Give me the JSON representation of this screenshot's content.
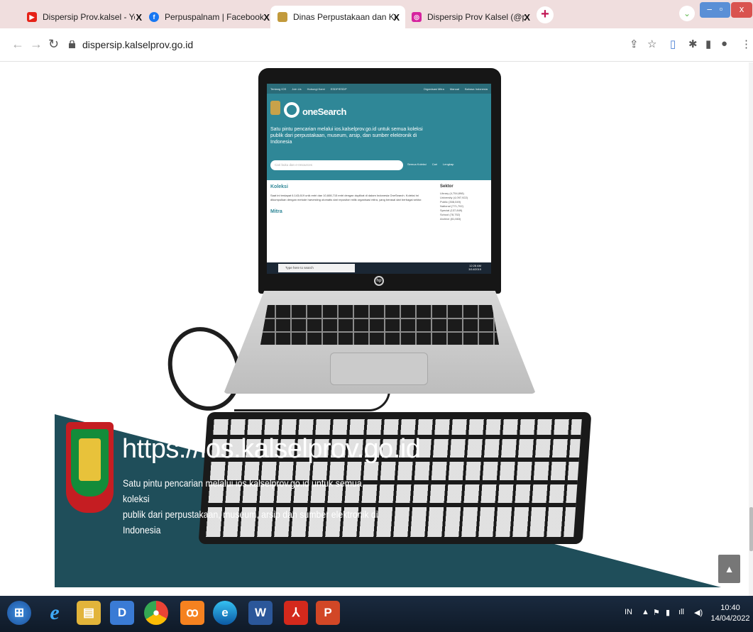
{
  "browser": {
    "tabs": [
      {
        "label": "Dispersip Prov.kalsel - YouTube",
        "icon": "youtube-icon",
        "active": false
      },
      {
        "label": "Perpuspalnam | Facebook",
        "icon": "facebook-icon",
        "active": false
      },
      {
        "label": "Dinas Perpustakaan dan Kearsipa",
        "icon": "site-crest-icon",
        "active": true
      },
      {
        "label": "Dispersip Prov Kalsel (@perpusp",
        "icon": "instagram-icon",
        "active": false
      }
    ],
    "tab_close": "X",
    "new_tab": "+",
    "url": "dispersip.kalselprov.go.id"
  },
  "laptop_screen": {
    "nav_items": [
      "Tentang IOS",
      "Join Us",
      "Hubungi Kami",
      "ESDP/ESDP"
    ],
    "nav_right": [
      "Organisasi Mitra",
      "Manual",
      "Bahasa Indonesia"
    ],
    "logo_text": "oneSearch",
    "hero_text": "Satu pintu pencarian melalui ios.kalselprov.go.id untuk semua koleksi publik dari perpustakaan, museum, arsip, dan sumber elektronik di Indonesia",
    "search_placeholder": "Cari buku dan e-resources",
    "search_buttons": [
      "Semua Koleksi",
      "Cari",
      "Lengkap"
    ],
    "section_koleksi": "Koleksi",
    "koleksi_text": "Saat ini terdapat 6.143,619 unik entri dan 10,608,715 entri dengan duplikat di dalam Indonesia OneSearch. Koleksi ini dikumpulkan dengan metode harvesting otomatis dari repositori milik organisasi mitra, yang berasal dari berbagai sektor.",
    "section_mitra": "Mitra",
    "sektor_title": "Sektor",
    "sektor_items": [
      "Library (4,754,898)",
      "University (4,097,922)",
      "Public (308,049)",
      "National (771,702)",
      "Special (137,849)",
      "School (78,752)",
      "Archive (81,663)"
    ],
    "taskbar_search": "Type here to search",
    "taskbar_time": "12:28 AM",
    "taskbar_date": "3/14/2019"
  },
  "banner": {
    "url": "https://ios.kalselprov.go.id",
    "line1": "Satu pintu pencarian melalui ios.kalselprov.go.id untuk semua koleksi",
    "line2": "publik dari perpustakaan, museum, arsip dan sumber elektronik di Indonesia"
  },
  "taskbar": {
    "apps": [
      "windows-start-icon",
      "internet-explorer-icon",
      "file-explorer-icon",
      "app-icon",
      "chrome-icon",
      "xampp-icon",
      "edge-icon",
      "word-icon",
      "acrobat-icon",
      "powerpoint-icon"
    ],
    "lang": "IN",
    "time": "10:40",
    "date": "14/04/2022"
  }
}
